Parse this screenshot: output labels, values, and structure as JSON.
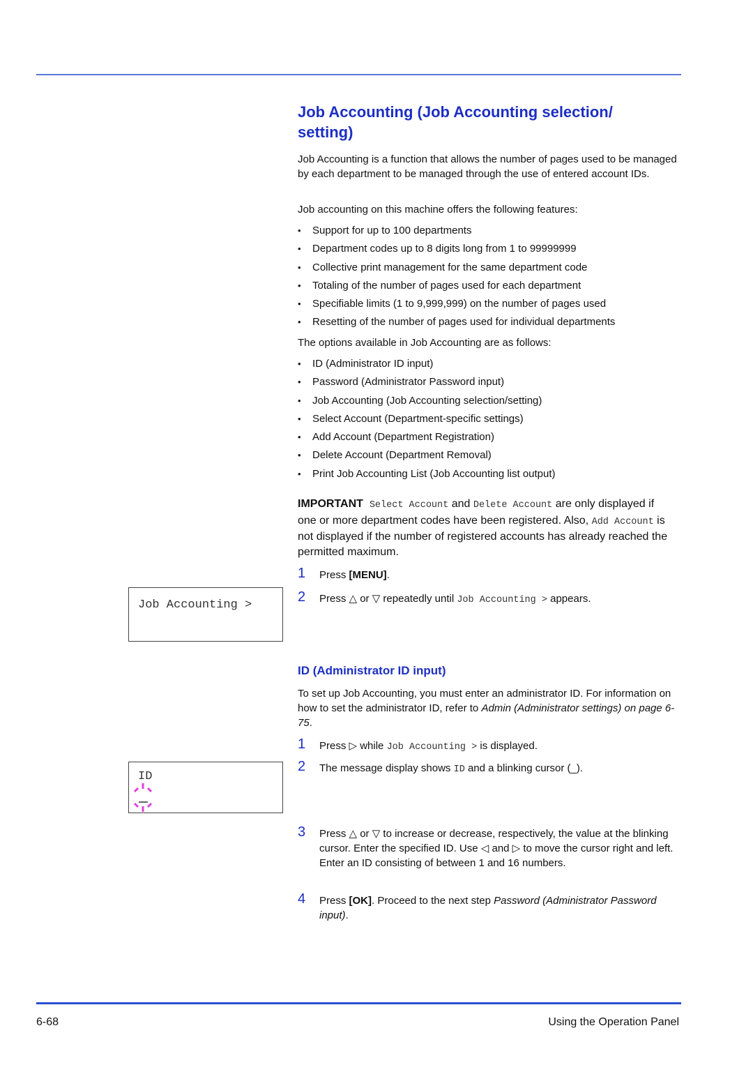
{
  "page": {
    "title": "Job Accounting (Job Accounting selection/ setting)",
    "intro": "Job Accounting is a function that allows the number of pages used to be managed by each department to be managed through the use of entered account IDs.",
    "features_intro": "Job accounting on this machine offers the following features:",
    "features": [
      "Support for up to 100 departments",
      "Department codes up to 8 digits long from 1 to 99999999",
      "Collective print management for the same department code",
      "Totaling of the number of pages used for each department",
      "Specifiable limits (1 to 9,999,999) on the number of pages used",
      "Resetting of the number of pages used for individual departments"
    ],
    "options_intro": "The options available in Job Accounting are as follows:",
    "options": [
      "ID (Administrator ID input)",
      "Password (Administrator Password input)",
      "Job Accounting (Job Accounting selection/setting)",
      "Select Account (Department-specific settings)",
      "Add Account (Department Registration)",
      "Delete Account (Department Removal)",
      "Print Job Accounting List (Job Accounting list output)"
    ],
    "important": {
      "label": "IMPORTANT",
      "code1": "Select Account",
      "and": "and",
      "code2": "Delete Account",
      "text1": "are only displayed if one or more department codes have been registered. Also,",
      "code3": "Add Account",
      "text2": "is not displayed if the number of registered accounts has already reached the permitted maximum."
    },
    "steps_a": [
      {
        "num": "1",
        "pre": "Press ",
        "bold": "[MENU]",
        "post": "."
      },
      {
        "num": "2",
        "pre": "Press △ or ▽ repeatedly until ",
        "code": "Job Accounting >",
        "post": " appears."
      }
    ],
    "lcd1": {
      "line1": "Job Accounting >"
    },
    "section2": {
      "title": "ID (Administrator ID input)",
      "intro_pre": "To set up Job Accounting, you must enter an administrator ID. For information on how to set the administrator ID, refer to ",
      "intro_link": "Admin (Administrator settings) on page 6-75",
      "intro_post": "."
    },
    "steps_b": [
      {
        "num": "1",
        "pre": "Press ▷ while ",
        "code": "Job Accounting >",
        "post": " is displayed."
      },
      {
        "num": "2",
        "pre": "The message display shows ",
        "code": "ID",
        "post": " and a blinking cursor (_)."
      },
      {
        "num": "3",
        "text": "Press △ or ▽ to increase or decrease, respectively, the value at the blinking cursor.  Enter the specified ID. Use ◁ and ▷ to move the cursor right and left. Enter an ID consisting of between 1 and 16 numbers."
      },
      {
        "num": "4",
        "pre": "Press ",
        "bold": "[OK]",
        "mid": ". Proceed to the next step ",
        "italic": "Password (Administrator Password input)",
        "post": "."
      }
    ],
    "lcd2": {
      "line1": "ID",
      "cursor": "_",
      "cursor_icon": "blinking-cursor-icon"
    },
    "footer": {
      "page_number": "6-68",
      "section": "Using the Operation Panel"
    },
    "colors": {
      "heading": "#1c2fc2",
      "rule": "#2a4fd0",
      "blink": "#e040e0"
    }
  }
}
